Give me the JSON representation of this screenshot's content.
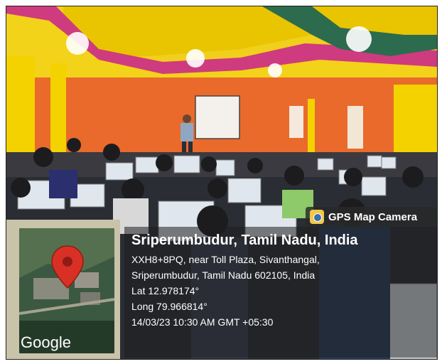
{
  "badge": {
    "label": "GPS Map Camera",
    "icon": "camera-icon"
  },
  "map": {
    "brand": "Google",
    "pin_color": "#d93025"
  },
  "location": {
    "title": "Sriperumbudur, Tamil Nadu, India",
    "address_line1": "XXH8+8PQ, near Toll Plaza, Sivanthangal,",
    "address_line2": "Sriperumbudur, Tamil Nadu 602105, India",
    "lat": "Lat 12.978174°",
    "long": "Long 79.966814°",
    "datetime": "14/03/23 10:30 AM GMT +05:30"
  },
  "colors": {
    "wall": "#e96a2b",
    "ceiling_yellow": "#f3d21a",
    "ceiling_band": "#c83a8a",
    "pillar": "#f4d200"
  }
}
